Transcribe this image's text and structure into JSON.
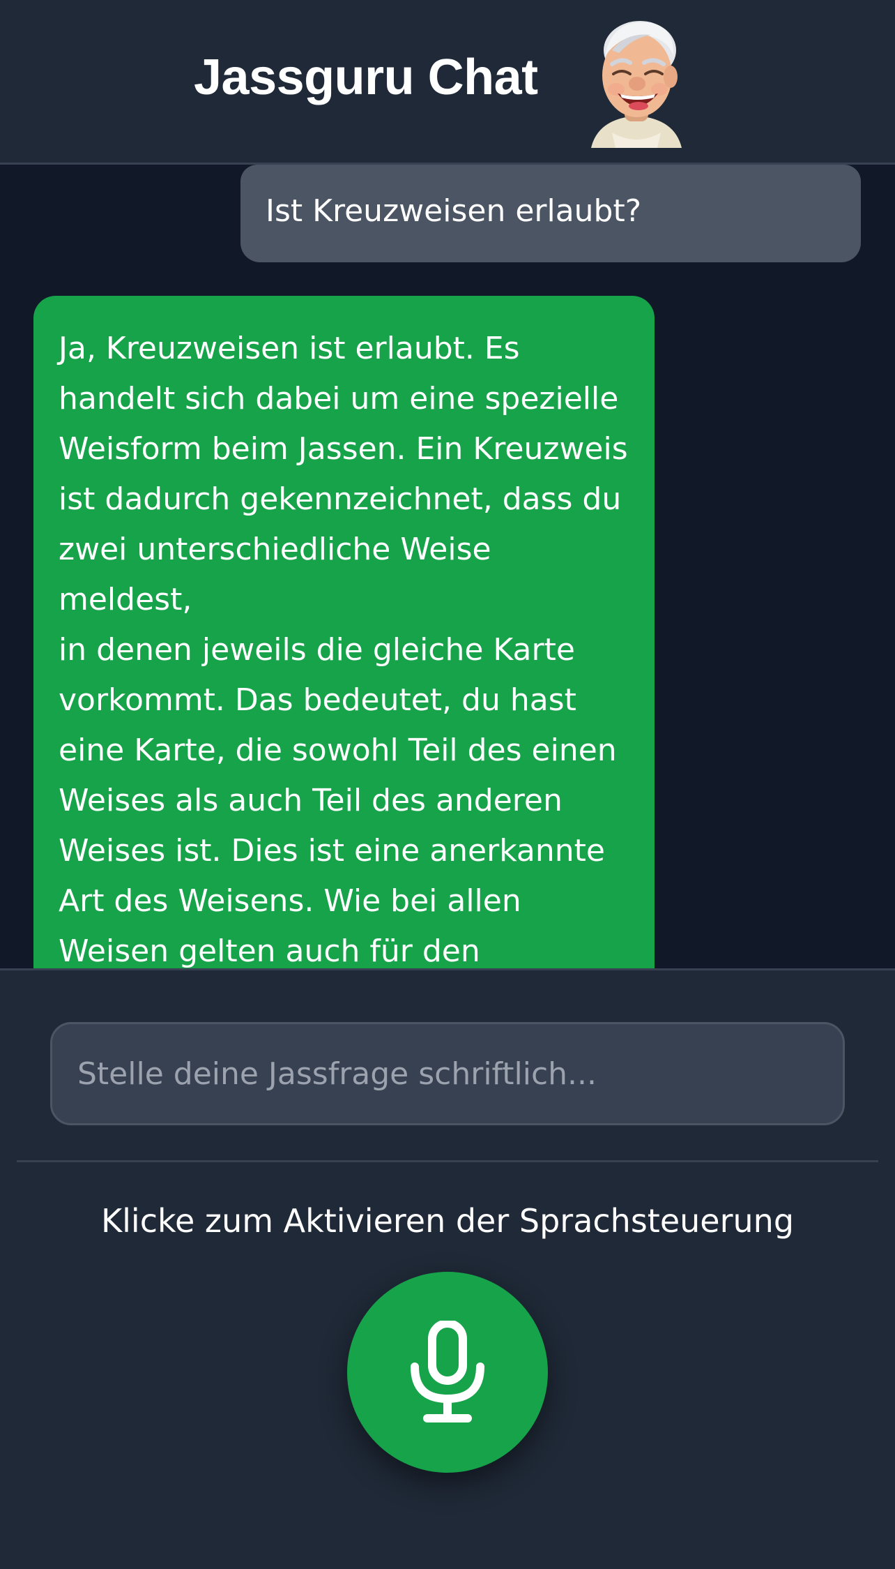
{
  "header": {
    "title": "Jassguru Chat",
    "avatar_icon": "laughing-old-man-avatar"
  },
  "chat": {
    "messages": [
      {
        "role": "user",
        "text": "Ist Kreuzweisen erlaubt?"
      },
      {
        "role": "assistant",
        "text": "Ja, Kreuzweisen ist erlaubt. Es\nhandelt sich dabei um eine spezielle\nWeisform beim Jassen. Ein Kreuzweis\nist dadurch gekennzeichnet, dass du\nzwei unterschiedliche Weise meldest,\nin denen jeweils die gleiche Karte\nvorkommt. Das bedeutet, du hast\neine Karte, die sowohl Teil des einen\nWeises als auch Teil des anderen\nWeises ist. Dies ist eine anerkannte\nArt des Weisens. Wie bei allen\nWeisen gelten auch für den\nKreuzweis die allgemeinen Weis-"
      }
    ],
    "user_bubble_color": "#4b5563",
    "assistant_bubble_color": "#16a34a"
  },
  "input": {
    "placeholder": "Stelle deine Jassfrage schriftlich...",
    "value": ""
  },
  "voice": {
    "hint": "Klicke zum Aktivieren der Sprachsteuerung",
    "mic_icon": "microphone-icon",
    "accent_color": "#16a34a"
  }
}
